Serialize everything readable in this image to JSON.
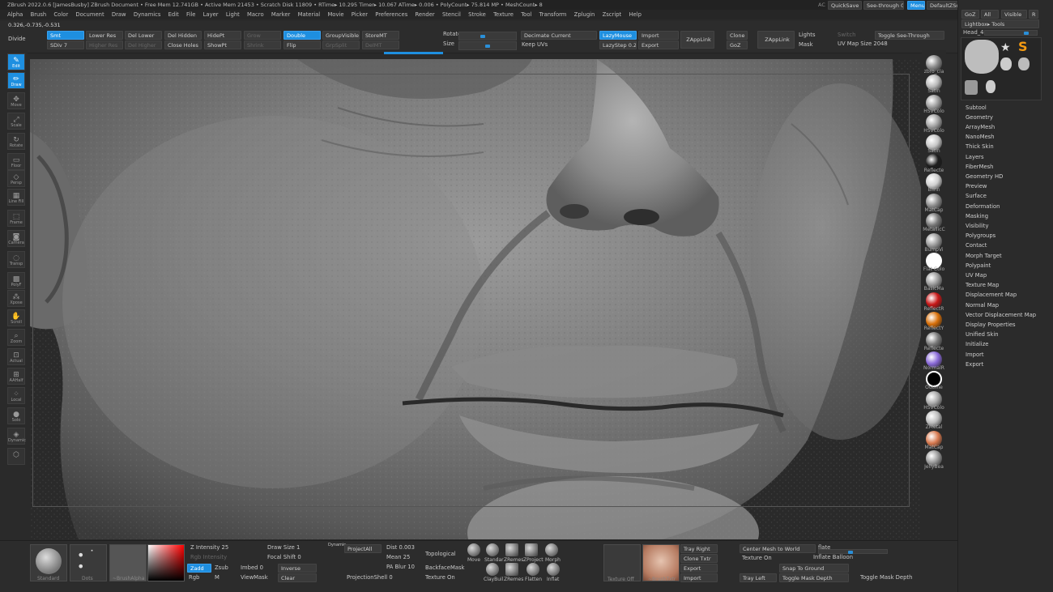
{
  "title_bar": "ZBrush 2022.0.6 [JamesBusby]   ZBrush Document      • Free Mem 12.741GB • Active Mem 21453 • Scratch Disk 11809 • RTime▸ 10.295 Timer▸ 10.067 ATime▸ 0.006 • PolyCount▸ 75.814 MP • MeshCount▸ 8",
  "top_right": {
    "ac": "AC",
    "quicksave": "QuickSave",
    "see_through": "See-through  0",
    "menus": "Menus",
    "default_script": "DefaultZScript"
  },
  "menu": [
    "Alpha",
    "Brush",
    "Color",
    "Document",
    "Draw",
    "Dynamics",
    "Edit",
    "File",
    "Layer",
    "Light",
    "Macro",
    "Marker",
    "Material",
    "Movie",
    "Picker",
    "Preferences",
    "Render",
    "Stencil",
    "Stroke",
    "Texture",
    "Tool",
    "Transform",
    "Zplugin",
    "Zscript",
    "Help"
  ],
  "coordinates": "0.326,-0.735,-0.531",
  "toolbar": {
    "divide": "Divide",
    "smt": "Smt",
    "sdiv": "SDiv 7",
    "lower_res": "Lower Res",
    "higher_res": "Higher Res",
    "del_lower": "Del Lower",
    "del_higher": "Del Higher",
    "del_hidden": "Del Hidden",
    "close_holes": "Close Holes",
    "hidept": "HidePt",
    "showpt": "ShowPt",
    "grow": "Grow",
    "shrink": "Shrink",
    "double": "Double",
    "flip": "Flip",
    "group_visible": "GroupVisible",
    "grp_split": "GrpSplit",
    "store_mt": "StoreMT",
    "del_mt": "DelMT",
    "rotate": "Rotate",
    "size": "Size",
    "decimate_current": "Decimate Current",
    "keep_uvs": "Keep UVs",
    "lazy_mouse": "LazyMouse",
    "lazy_step": "LazyStep 0.25",
    "import": "Import",
    "export": "Export",
    "zapplink": "ZAppLink",
    "clone": "Clone",
    "goz": "GoZ",
    "zapplink2": "ZAppLink",
    "lights": "Lights",
    "mask": "Mask",
    "switch": "Switch",
    "toggle_see_through": "Toggle See-Through",
    "uv_map_size": "UV Map Size 2048"
  },
  "left_shelf": [
    "Edit",
    "Draw",
    "Move",
    "Scale",
    "Rotate",
    "Floor",
    "Persp",
    "Line Fill",
    "Frame",
    "Camera",
    "Transp",
    "PolyF",
    "Xpose",
    "Scroll",
    "Zoom",
    "Actual",
    "AAHalf",
    "Local",
    "Solo",
    "Dynamic"
  ],
  "materials": [
    {
      "label": "zbro_cla",
      "color": "#8a8a8a"
    },
    {
      "label": "Satin",
      "color": "#b8b8b8"
    },
    {
      "label": "HSVColo",
      "color": "#9c9c9c"
    },
    {
      "label": "HSVColo",
      "color": "#a2a2a2"
    },
    {
      "label": "Satin",
      "color": "#c6c6c6"
    },
    {
      "label": "Reflecte",
      "color": "#1e1e1e"
    },
    {
      "label": "Blinn",
      "color": "#cfcfcf"
    },
    {
      "label": "MatCap",
      "color": "#8c8c8c"
    },
    {
      "label": "MetallicC",
      "color": "#777777"
    },
    {
      "label": "BumpVi",
      "color": "#9a9a9a"
    },
    {
      "label": "Flat Colo",
      "color": "#ffffff"
    },
    {
      "label": "BasicMa",
      "color": "#9a9a9a"
    },
    {
      "label": "ReflectR",
      "color": "#c81818"
    },
    {
      "label": "ReflectY",
      "color": "#d8700a"
    },
    {
      "label": "Reflecte",
      "color": "#7a7a7a"
    },
    {
      "label": "NormalR",
      "color": "#8a6ad8"
    },
    {
      "label": "Outline",
      "color": "#000000"
    },
    {
      "label": "HSVColo",
      "color": "#a8a8a8"
    },
    {
      "label": "ZMetal",
      "color": "#bcbcbc"
    },
    {
      "label": "MatCap",
      "color": "#d87a50"
    },
    {
      "label": "JellyBea",
      "color": "#9a9a9a"
    }
  ],
  "right_panel": {
    "goz": "GoZ",
    "all": "All",
    "visible": "Visible",
    "r": "R",
    "lightbox_tools": "Lightbox▸ Tools",
    "head": "Head_48",
    "thumbs": [
      "Head_48",
      "PolyMesh",
      "SimpleBr",
      "Head_48",
      "Head_48",
      "Base Me",
      "Cylinder",
      "Head_48"
    ],
    "menu": [
      "Subtool",
      "Geometry",
      "ArrayMesh",
      "NanoMesh",
      "Thick Skin",
      "Layers",
      "FiberMesh",
      "Geometry HD",
      "Preview",
      "Surface",
      "Deformation",
      "Masking",
      "Visibility",
      "Polygroups",
      "Contact",
      "Morph Target",
      "Polypaint",
      "UV Map",
      "Texture Map",
      "Displacement Map",
      "Normal Map",
      "Vector Displacement Map",
      "Display Properties",
      "Unified Skin",
      "Initialize",
      "Import",
      "Export"
    ]
  },
  "bottom": {
    "brush_label": "Standard",
    "stroke_label": "Dots",
    "alpha_label": "~BrushAlpha",
    "z_intensity": "Z Intensity 25",
    "rgb_intensity": "Rgb Intensity",
    "zadd": "Zadd",
    "zsub": "Zsub",
    "rgb": "Rgb",
    "m": "M",
    "draw_size": "Draw Size 1",
    "dynamic": "Dynamic",
    "focal_shift": "Focal Shift 0",
    "imbed": "Imbed 0",
    "view_mask": "ViewMask",
    "inverse": "Inverse",
    "clear": "Clear",
    "project_all": "ProjectAll",
    "dist": "Dist 0.003",
    "mean": "Mean 25",
    "pa_blur": "PA Blur 10",
    "projection_shell": "ProjectionShell 0",
    "topological": "Topological",
    "backface_mask": "BackfaceMask",
    "texture_on": "Texture On",
    "brushes": [
      "Move",
      "Standar",
      "ZRemes",
      "ZProject",
      "Morph",
      "ClayBuil",
      "ZRemes",
      "Flatten",
      "Inflat"
    ],
    "texture_off": "Texture Off",
    "brush_txtr": "~BrushTxtr",
    "tray_right": "Tray Right",
    "clone_txtr": "Clone Txtr",
    "export": "Export",
    "import": "Import",
    "tray_left": "Tray Left",
    "center_mesh": "Center Mesh to World",
    "texture_on2": "Texture On",
    "flate": "flate",
    "inflate_balloon": "Inflate Balloon",
    "snap_to_ground": "Snap To Ground",
    "toggle_mask_depth": "Toggle Mask Depth",
    "toggle_mask_depth2": "Toggle Mask Depth"
  }
}
